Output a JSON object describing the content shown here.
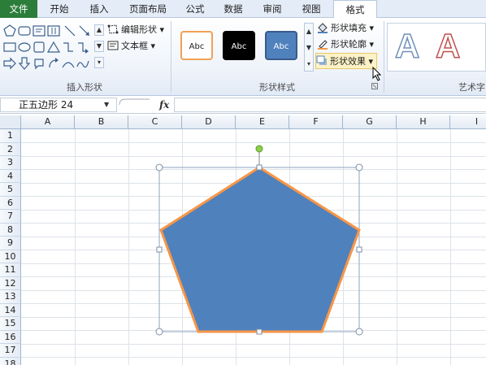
{
  "tabs": [
    {
      "label": "文件"
    },
    {
      "label": "开始"
    },
    {
      "label": "插入"
    },
    {
      "label": "页面布局"
    },
    {
      "label": "公式"
    },
    {
      "label": "数据"
    },
    {
      "label": "审阅"
    },
    {
      "label": "视图"
    },
    {
      "label": "格式"
    }
  ],
  "ribbon": {
    "insert_shapes": {
      "edit_shape_label": "编辑形状",
      "text_box_label": "文本框",
      "group_label": "插入形状"
    },
    "shape_styles": {
      "swatches": [
        {
          "label": "Abc",
          "fill": "#ffffff",
          "border": "#f0a155",
          "text": "#222222"
        },
        {
          "label": "Abc",
          "fill": "#000000",
          "border": "#000000",
          "text": "#ffffff"
        },
        {
          "label": "Abc",
          "fill": "#4f81bd",
          "border": "#385d8a",
          "text": "#ffffff"
        }
      ],
      "shape_fill_label": "形状填充",
      "shape_outline_label": "形状轮廓",
      "shape_effects_label": "形状效果",
      "group_label": "形状样式"
    },
    "wordart": {
      "sample_1": "A",
      "sample_2": "A",
      "group_label": "艺术字"
    }
  },
  "formula_bar": {
    "name_box_value": "正五边形 24",
    "fx_label": "fx",
    "formula_value": ""
  },
  "sheet": {
    "columns": [
      "A",
      "B",
      "C",
      "D",
      "E",
      "F",
      "G",
      "H",
      "I"
    ],
    "rows": [
      "1",
      "2",
      "3",
      "4",
      "5",
      "6",
      "7",
      "8",
      "9",
      "10",
      "11",
      "12",
      "13",
      "14",
      "15",
      "16",
      "17",
      "18"
    ],
    "shape": {
      "type": "regular-pentagon",
      "fill": "#4f81bd",
      "outline": "#f79646",
      "selected": true
    }
  },
  "colors": {
    "file_tab": "#2d7d3a",
    "ribbon_bg": "#eef3fa",
    "accent": "#4f81bd"
  }
}
